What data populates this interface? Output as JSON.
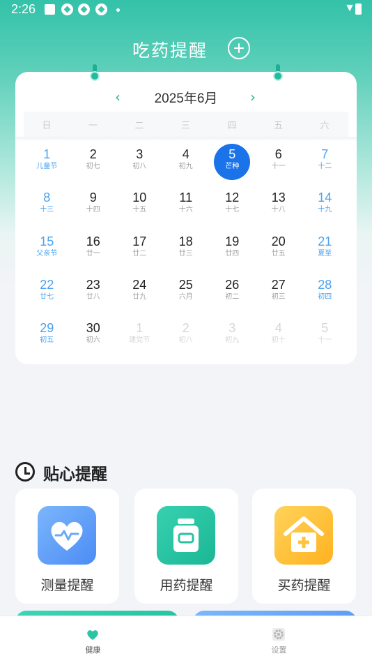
{
  "status_bar": {
    "time": "2:26"
  },
  "header": {
    "title": "吃药提醒"
  },
  "calendar": {
    "month_label": "2025年6月",
    "weekdays": [
      "日",
      "一",
      "二",
      "三",
      "四",
      "五",
      "六"
    ],
    "weeks": [
      [
        {
          "day": "1",
          "lunar": "儿童节",
          "kind": "weekend"
        },
        {
          "day": "2",
          "lunar": "初七",
          "kind": "normal"
        },
        {
          "day": "3",
          "lunar": "初八",
          "kind": "normal"
        },
        {
          "day": "4",
          "lunar": "初九",
          "kind": "normal"
        },
        {
          "day": "5",
          "lunar": "芒种",
          "kind": "today"
        },
        {
          "day": "6",
          "lunar": "十一",
          "kind": "normal"
        },
        {
          "day": "7",
          "lunar": "十二",
          "kind": "weekend"
        }
      ],
      [
        {
          "day": "8",
          "lunar": "十三",
          "kind": "weekend"
        },
        {
          "day": "9",
          "lunar": "十四",
          "kind": "normal"
        },
        {
          "day": "10",
          "lunar": "十五",
          "kind": "normal"
        },
        {
          "day": "11",
          "lunar": "十六",
          "kind": "normal"
        },
        {
          "day": "12",
          "lunar": "十七",
          "kind": "normal"
        },
        {
          "day": "13",
          "lunar": "十八",
          "kind": "normal"
        },
        {
          "day": "14",
          "lunar": "十九",
          "kind": "weekend"
        }
      ],
      [
        {
          "day": "15",
          "lunar": "父亲节",
          "kind": "weekend"
        },
        {
          "day": "16",
          "lunar": "廿一",
          "kind": "normal"
        },
        {
          "day": "17",
          "lunar": "廿二",
          "kind": "normal"
        },
        {
          "day": "18",
          "lunar": "廿三",
          "kind": "normal"
        },
        {
          "day": "19",
          "lunar": "廿四",
          "kind": "normal"
        },
        {
          "day": "20",
          "lunar": "廿五",
          "kind": "normal"
        },
        {
          "day": "21",
          "lunar": "夏至",
          "kind": "weekend"
        }
      ],
      [
        {
          "day": "22",
          "lunar": "廿七",
          "kind": "weekend"
        },
        {
          "day": "23",
          "lunar": "廿八",
          "kind": "normal"
        },
        {
          "day": "24",
          "lunar": "廿九",
          "kind": "normal"
        },
        {
          "day": "25",
          "lunar": "六月",
          "kind": "normal"
        },
        {
          "day": "26",
          "lunar": "初二",
          "kind": "normal"
        },
        {
          "day": "27",
          "lunar": "初三",
          "kind": "normal"
        },
        {
          "day": "28",
          "lunar": "初四",
          "kind": "weekend"
        }
      ],
      [
        {
          "day": "29",
          "lunar": "初五",
          "kind": "weekend"
        },
        {
          "day": "30",
          "lunar": "初六",
          "kind": "normal"
        },
        {
          "day": "1",
          "lunar": "建党节",
          "kind": "other"
        },
        {
          "day": "2",
          "lunar": "初八",
          "kind": "other"
        },
        {
          "day": "3",
          "lunar": "初九",
          "kind": "other"
        },
        {
          "day": "4",
          "lunar": "初十",
          "kind": "other"
        },
        {
          "day": "5",
          "lunar": "十一",
          "kind": "other"
        }
      ]
    ]
  },
  "reminders": {
    "section_title": "贴心提醒",
    "cards": [
      {
        "label": "测量提醒",
        "icon": "heart-pulse-icon"
      },
      {
        "label": "用药提醒",
        "icon": "medicine-bottle-icon"
      },
      {
        "label": "买药提醒",
        "icon": "pharmacy-house-icon"
      }
    ]
  },
  "tabbar": {
    "items": [
      {
        "label": "健康",
        "icon": "heart-icon",
        "active": true
      },
      {
        "label": "设置",
        "icon": "gear-icon",
        "active": false
      }
    ]
  },
  "colors": {
    "accent": "#22b49a",
    "today": "#1a73e8",
    "weekend": "#4aa2f0"
  }
}
